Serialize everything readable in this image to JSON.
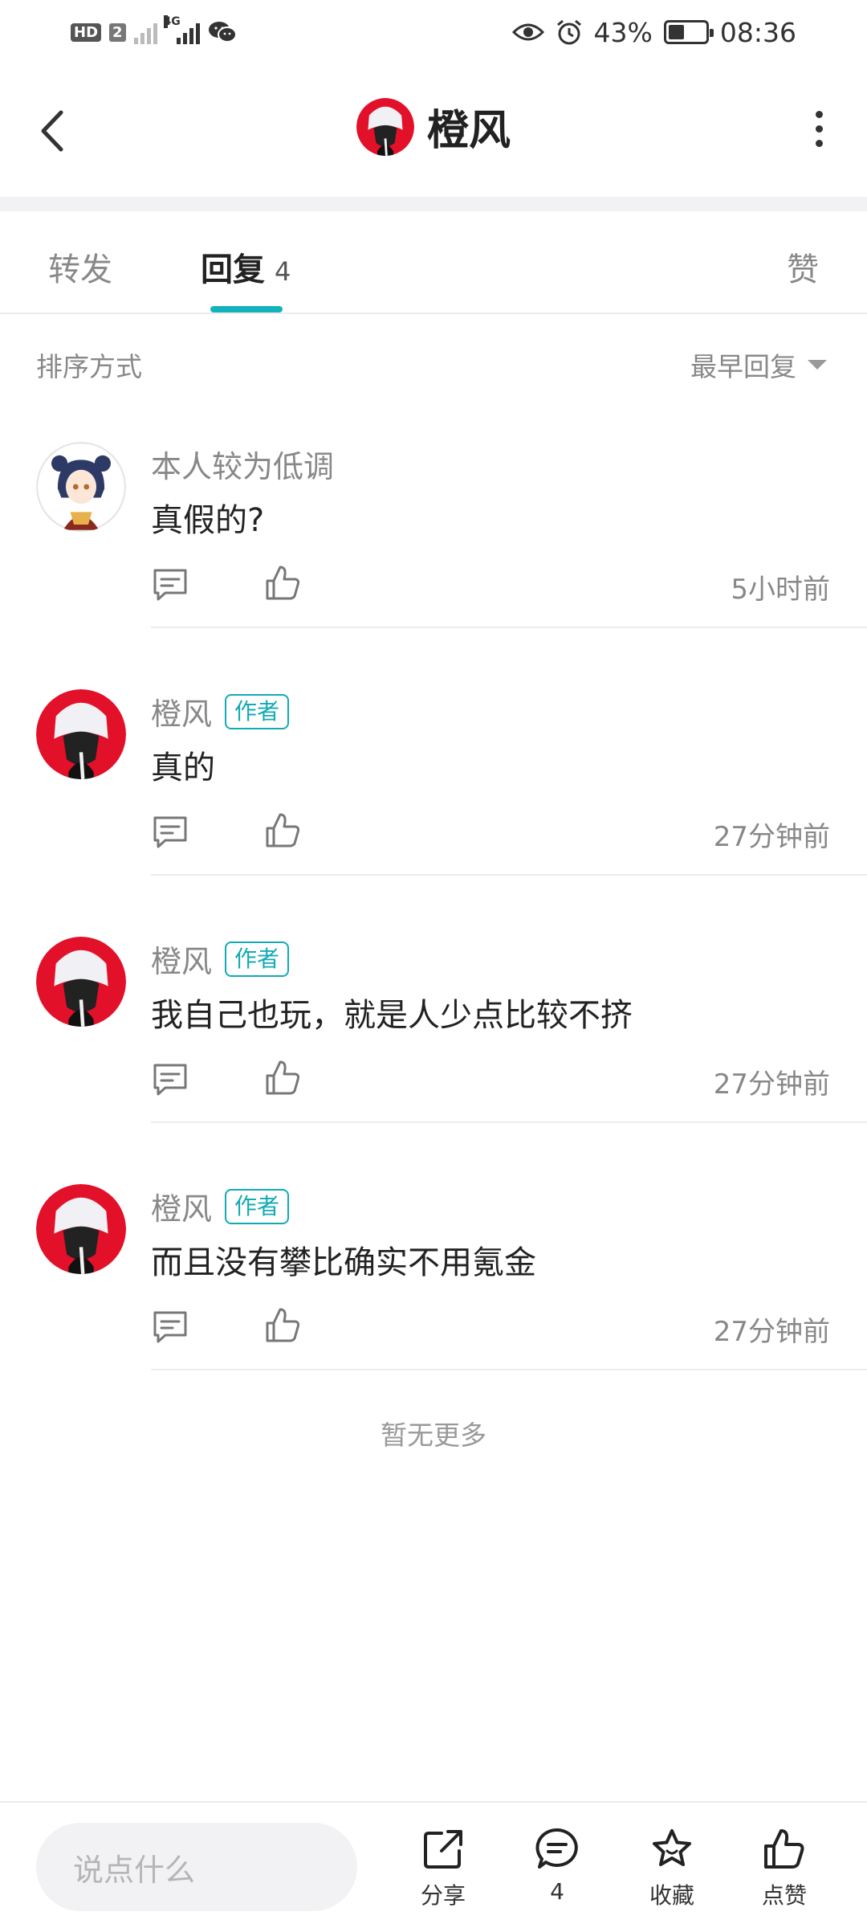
{
  "status_bar": {
    "hd": "HD",
    "hd_num": "2",
    "net": "4G",
    "battery_text": "43%",
    "battery_level": 0.43,
    "time": "08:36"
  },
  "header": {
    "title": "橙风"
  },
  "tabs": {
    "forward": "转发",
    "reply": "回复",
    "reply_count": "4",
    "like": "赞"
  },
  "sort": {
    "label": "排序方式",
    "value": "最早回复"
  },
  "comments": [
    {
      "author": "本人较为低调",
      "badge": "",
      "text": "真假的?",
      "time": "5小时前"
    },
    {
      "author": "橙风",
      "badge": "作者",
      "text": "真的",
      "time": "27分钟前"
    },
    {
      "author": "橙风",
      "badge": "作者",
      "text": "我自己也玩，就是人少点比较不挤",
      "time": "27分钟前"
    },
    {
      "author": "橙风",
      "badge": "作者",
      "text": "而且没有攀比确实不用氪金",
      "time": "27分钟前"
    }
  ],
  "no_more": "暂无更多",
  "bottom_bar": {
    "input_placeholder": "说点什么",
    "share": "分享",
    "comments": "4",
    "favorite": "收藏",
    "like": "点赞"
  },
  "colors": {
    "accent": "#13b3bd",
    "badge": "#13aab4"
  }
}
